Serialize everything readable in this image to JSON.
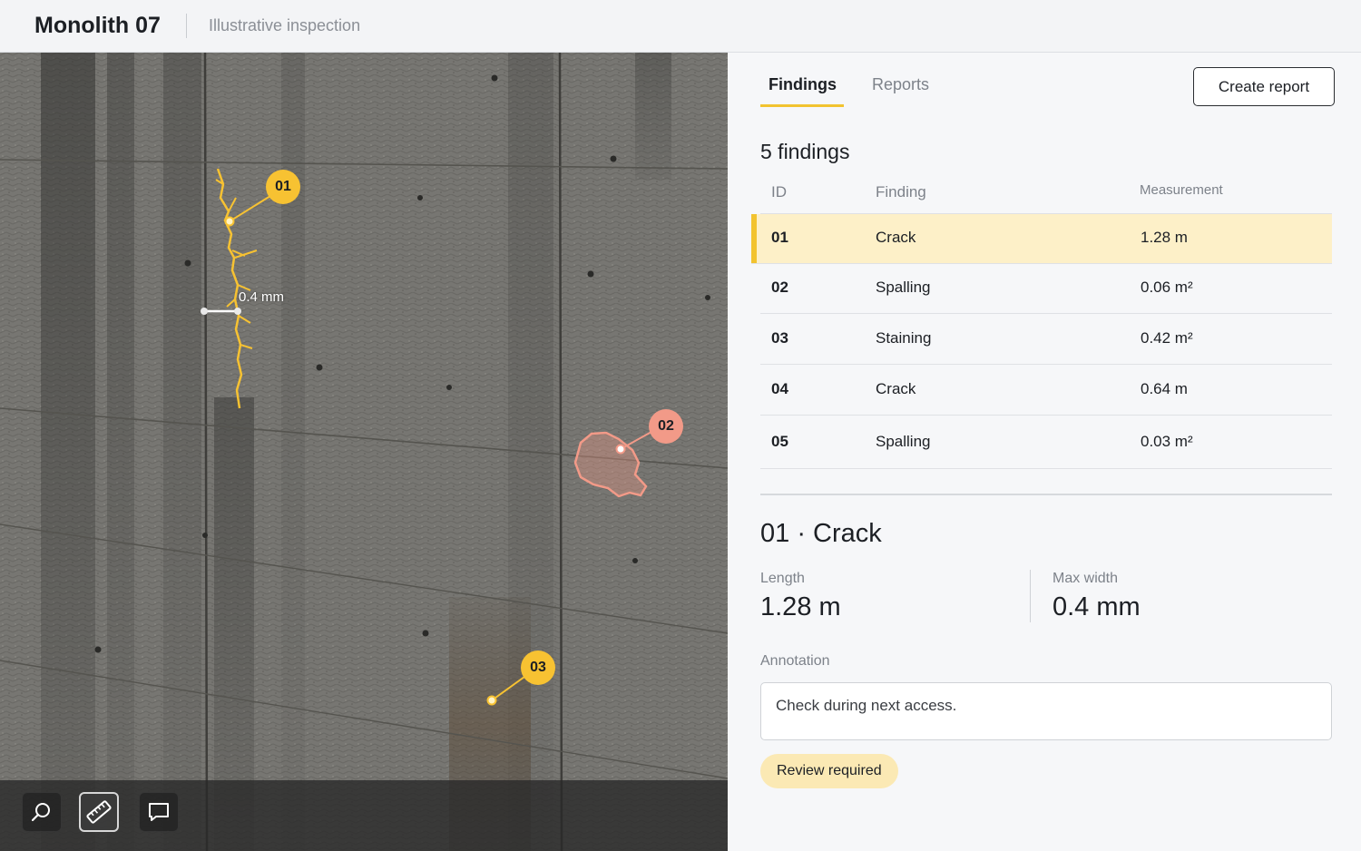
{
  "header": {
    "title": "Monolith 07",
    "subtitle": "Illustrative inspection"
  },
  "viewer": {
    "markers": [
      "01",
      "02",
      "03"
    ],
    "dimension_label": "0.4 mm",
    "tools": [
      "search-icon",
      "ruler-icon",
      "comment-icon"
    ],
    "active_tool": "ruler-icon",
    "colors": {
      "crack": "#f7c232",
      "spalling": "#f29a88"
    }
  },
  "panel": {
    "tabs": [
      "Findings",
      "Reports"
    ],
    "active_tab": "Findings",
    "create_button": "Create report",
    "count_label": "5 findings",
    "columns": {
      "id": "ID",
      "finding": "Finding",
      "measurement": "Measurement"
    },
    "rows": [
      {
        "id": "01",
        "finding": "Crack",
        "measurement": "1.28 m"
      },
      {
        "id": "02",
        "finding": "Spalling",
        "measurement": "0.06 m²"
      },
      {
        "id": "03",
        "finding": "Staining",
        "measurement": "0.42 m²"
      },
      {
        "id": "04",
        "finding": "Crack",
        "measurement": "0.64 m"
      },
      {
        "id": "05",
        "finding": "Spalling",
        "measurement": "0.03 m²"
      }
    ],
    "selected_row": "01",
    "accent_color": "#f2c32f"
  },
  "detail": {
    "title": "01 · Crack",
    "length_label": "Length",
    "length_value": "1.28 m",
    "width_label": "Max width",
    "width_value": "0.4 mm",
    "annotation_label": "Annotation",
    "annotation_text": "Check during next access.",
    "status_badge": "Review required"
  }
}
